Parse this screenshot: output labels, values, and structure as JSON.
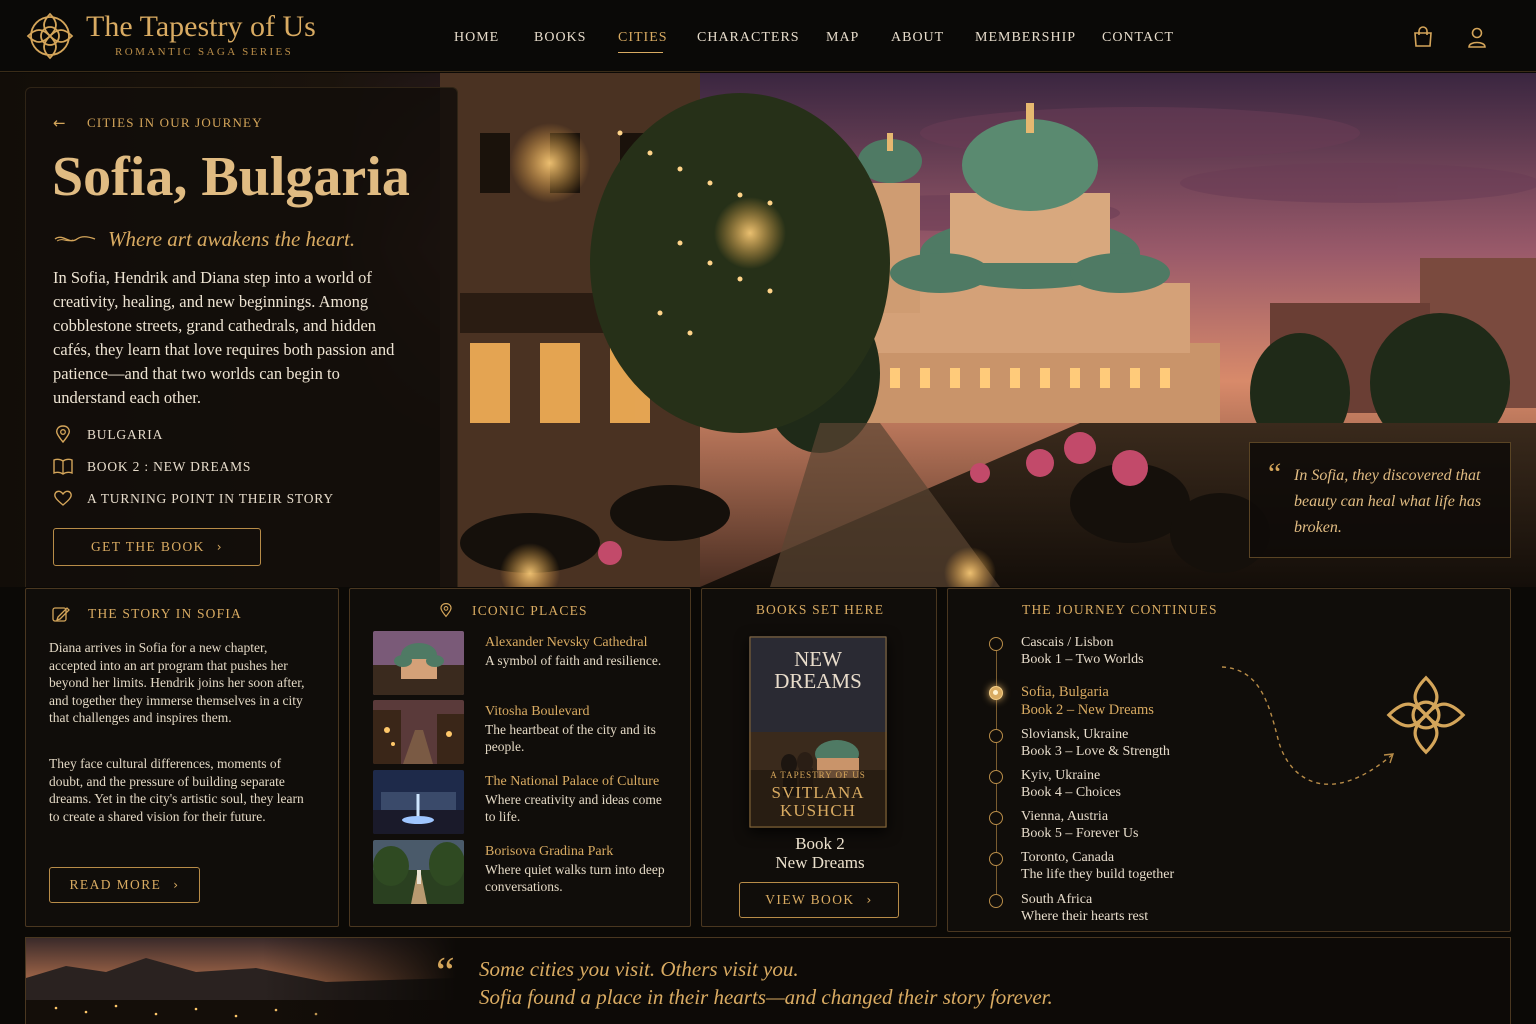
{
  "brand": {
    "title": "The Tapestry of Us",
    "subtitle": "ROMANTIC SAGA SERIES"
  },
  "nav": {
    "items": [
      "HOME",
      "BOOKS",
      "CITIES",
      "CHARACTERS",
      "MAP",
      "ABOUT",
      "MEMBERSHIP",
      "CONTACT"
    ],
    "active": "CITIES"
  },
  "hero": {
    "back_label": "CITIES IN OUR JOURNEY",
    "title": "Sofia, Bulgaria",
    "tagline": "Where art awakens the heart.",
    "body": "In Sofia, Hendrik and Diana step into a world of creativity, healing, and new beginnings. Among cobblestone streets, grand cathedrals, and hidden cafés, they learn that love requires both passion and patience—and that two worlds can begin to understand each other.",
    "meta": {
      "country": "BULGARIA",
      "book": "BOOK 2 : NEW DREAMS",
      "note": "A TURNING POINT IN THEIR STORY"
    },
    "cta": "GET THE BOOK",
    "quote": "In Sofia, they discovered that beauty can heal what life has broken."
  },
  "story": {
    "heading": "THE STORY IN SOFIA",
    "p1": "Diana arrives in Sofia for a new chapter, accepted into an art program that pushes her beyond her limits. Hendrik joins her soon after, and together they immerse themselves in a city that challenges and inspires them.",
    "p2": "They face cultural differences, moments of doubt, and the pressure of building separate dreams. Yet in the city's artistic soul, they learn to create a shared vision for their future.",
    "cta": "READ MORE"
  },
  "places": {
    "heading": "ICONIC PLACES",
    "items": [
      {
        "name": "Alexander Nevsky Cathedral",
        "desc": "A symbol of faith and resilience."
      },
      {
        "name": "Vitosha Boulevard",
        "desc": "The heartbeat of the city and its people."
      },
      {
        "name": "The National Palace of Culture",
        "desc": "Where creativity and ideas come to life."
      },
      {
        "name": "Borisova Gradina Park",
        "desc": "Where quiet walks turn into deep conversations."
      }
    ]
  },
  "books": {
    "heading": "BOOKS SET HERE",
    "cover": {
      "title_1": "NEW",
      "title_2": "DREAMS",
      "series": "A TAPESTRY OF US",
      "author_1": "SVITLANA",
      "author_2": "KUSHCH"
    },
    "label_1": "Book 2",
    "label_2": "New Dreams",
    "cta": "VIEW BOOK"
  },
  "journey": {
    "heading": "THE JOURNEY CONTINUES",
    "items": [
      {
        "city": "Cascais / Lisbon",
        "book": "Book 1 – Two Worlds",
        "active": false
      },
      {
        "city": "Sofia, Bulgaria",
        "book": "Book 2 – New Dreams",
        "active": true
      },
      {
        "city": "Sloviansk, Ukraine",
        "book": "Book 3 – Love & Strength",
        "active": false
      },
      {
        "city": "Kyiv, Ukraine",
        "book": "Book 4 – Choices",
        "active": false
      },
      {
        "city": "Vienna, Austria",
        "book": "Book 5 – Forever Us",
        "active": false
      },
      {
        "city": "Toronto, Canada",
        "book": "The life they build together",
        "active": false
      },
      {
        "city": "South Africa",
        "book": "Where their hearts rest",
        "active": false
      }
    ]
  },
  "banner": {
    "line_1": "Some cities you visit. Others visit you.",
    "line_2": "Sofia found a place in their hearts—and changed their story forever."
  },
  "icons": [
    "celtic-knot-logo",
    "shopping-bag-icon",
    "user-icon",
    "arrow-left-icon",
    "map-pin-icon",
    "book-icon",
    "heart-icon",
    "pen-icon",
    "chevron-right-icon",
    "quote-icon"
  ],
  "colors": {
    "gold": "#d9ab62",
    "background": "#0b0906",
    "border": "#4a3720"
  }
}
